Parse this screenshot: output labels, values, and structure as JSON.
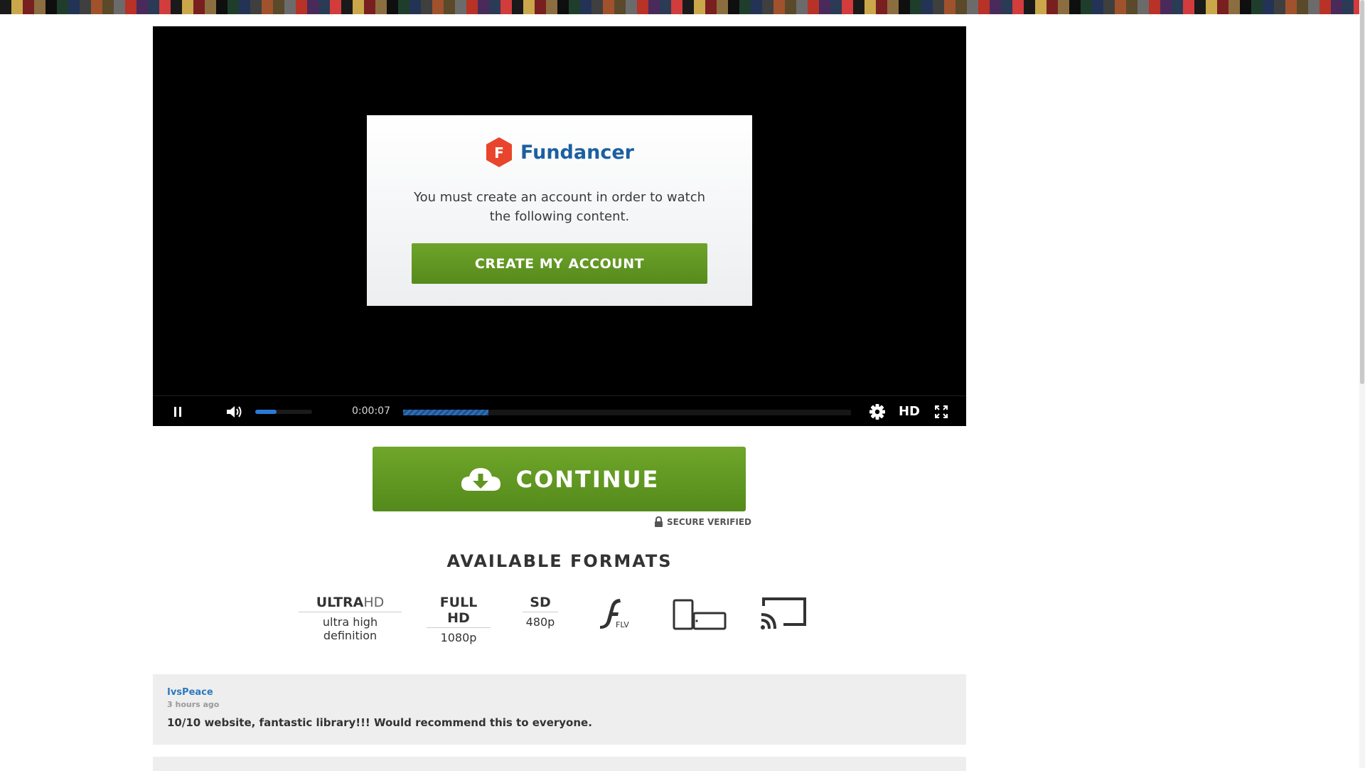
{
  "player": {
    "modal": {
      "brand_letter": "F",
      "brand_name": "Fundancer",
      "message": "You must create an account in order to watch the following content.",
      "cta_label": "CREATE MY ACCOUNT"
    },
    "controls": {
      "time": "0:00:07",
      "quality_label": "HD",
      "volume_fraction": 0.38,
      "progress_fraction": 0.19
    }
  },
  "continue": {
    "label": "CONTINUE",
    "secure_label": "SECURE VERIFIED"
  },
  "formats": {
    "title": "AVAILABLE FORMATS",
    "items": [
      {
        "title_bold": "ULTRA",
        "title_light": "HD",
        "subtitle": "ultra high definition"
      },
      {
        "title_bold": "FULL HD",
        "subtitle": "1080p"
      },
      {
        "title_bold": "SD",
        "subtitle": "480p"
      },
      {
        "label": "FLV",
        "icon": "flash-flv-icon"
      },
      {
        "icon": "devices-icon"
      },
      {
        "icon": "cast-icon"
      }
    ]
  },
  "comments": [
    {
      "user": "IvsPeace",
      "when": "3 hours ago",
      "text": "10/10 website, fantastic library!!! Would recommend this to everyone."
    }
  ],
  "colors": {
    "accent_green": "#6ea42a",
    "brand_blue": "#1b5fa0",
    "brand_red": "#e8452c",
    "player_blue": "#2a7ad6"
  }
}
